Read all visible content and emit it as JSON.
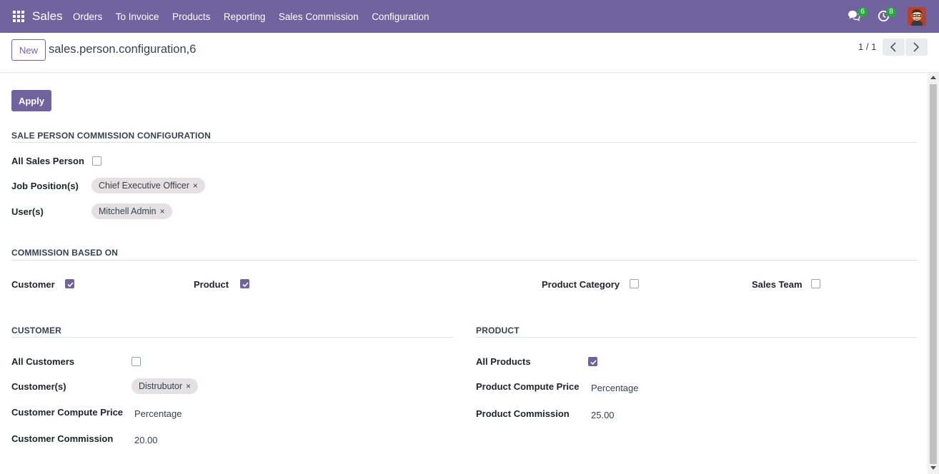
{
  "navbar": {
    "app_name": "Sales",
    "menu": [
      "Orders",
      "To Invoice",
      "Products",
      "Reporting",
      "Sales Commission",
      "Configuration"
    ],
    "chat_count": "6",
    "activity_count": "8",
    "color": "#71639e"
  },
  "control_panel": {
    "new_label": "New",
    "record_title": "sales.person.configuration,6",
    "pager": "1 / 1"
  },
  "form": {
    "apply_label": "Apply",
    "config_section": {
      "title": "SALE PERSON COMMISSION CONFIGURATION",
      "all_sales_person_label": "All Sales Person",
      "all_sales_person_checked": false,
      "job_positions_label": "Job Position(s)",
      "job_positions": [
        "Chief Executive Officer"
      ],
      "users_label": "User(s)",
      "users": [
        "Mitchell Admin"
      ]
    },
    "based_on_section": {
      "title": "COMMISSION BASED ON",
      "customer_label": "Customer",
      "customer_checked": true,
      "product_label": "Product",
      "product_checked": true,
      "product_category_label": "Product Category",
      "product_category_checked": false,
      "sales_team_label": "Sales Team",
      "sales_team_checked": false
    },
    "customer_section": {
      "title": "CUSTOMER",
      "all_customers_label": "All Customers",
      "all_customers_checked": false,
      "customers_label": "Customer(s)",
      "customers": [
        "Distrubutor"
      ],
      "compute_price_label": "Customer Compute Price",
      "compute_price_value": "Percentage",
      "commission_label": "Customer Commission",
      "commission_value": "20.00"
    },
    "product_section": {
      "title": "PRODUCT",
      "all_products_label": "All Products",
      "all_products_checked": true,
      "compute_price_label": "Product Compute Price",
      "compute_price_value": "Percentage",
      "commission_label": "Product Commission",
      "commission_value": "25.00"
    }
  },
  "icons": {
    "apps": "apps-grid-icon",
    "chat": "chat-icon",
    "activity": "clock-icon",
    "remove": "×"
  }
}
